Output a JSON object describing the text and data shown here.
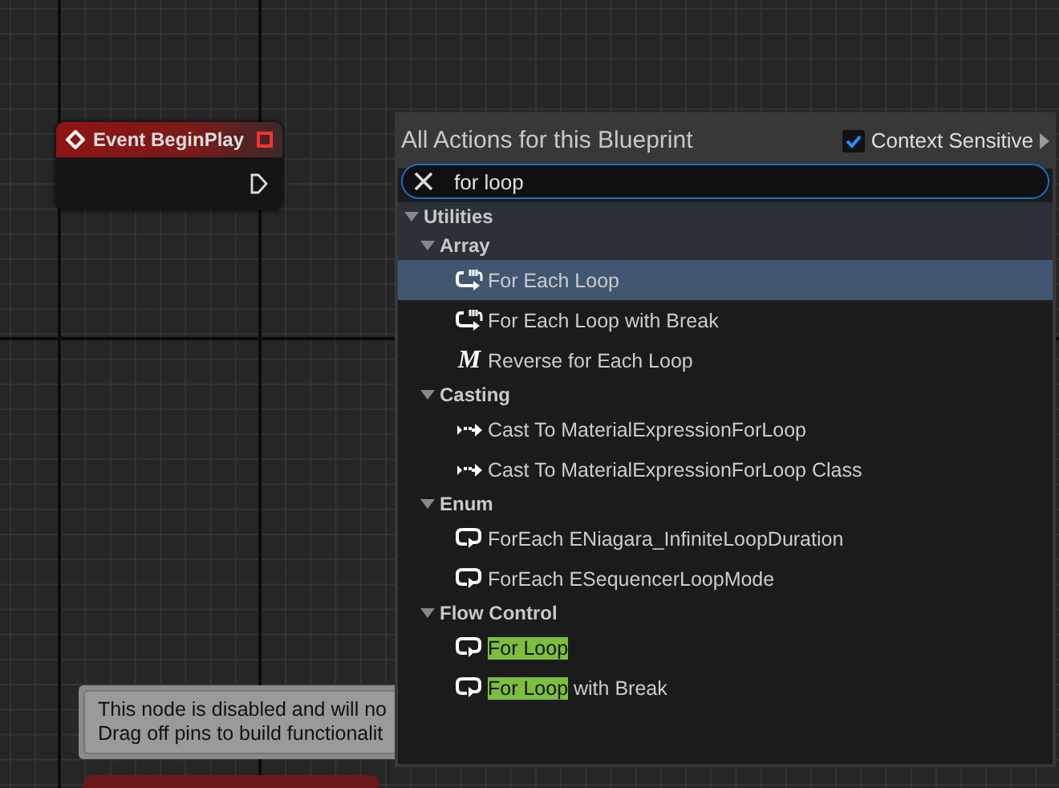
{
  "event_node": {
    "title": "Event BeginPlay"
  },
  "tooltip": {
    "lines": [
      "This node is disabled and will no",
      "Drag off pins to build functionalit"
    ]
  },
  "menu": {
    "title": "All Actions for this Blueprint",
    "context_sensitive": {
      "label": "Context Sensitive",
      "checked": true
    },
    "search": {
      "value": "for loop"
    },
    "tree": [
      {
        "label": "Utilities",
        "expanded": true,
        "children": [
          {
            "label": "Array",
            "expanded": true,
            "children": [
              {
                "kind": "loop",
                "selected": true,
                "parts": [
                  {
                    "text": "For Each Loop",
                    "highlighted": false
                  }
                ]
              },
              {
                "kind": "loop",
                "selected": false,
                "parts": [
                  {
                    "text": "For Each Loop with Break",
                    "highlighted": false
                  }
                ]
              },
              {
                "kind": "macro",
                "icon_text": "M",
                "selected": false,
                "parts": [
                  {
                    "text": "Reverse for Each Loop",
                    "highlighted": false
                  }
                ]
              }
            ]
          },
          {
            "label": "Casting",
            "expanded": true,
            "children": [
              {
                "kind": "cast",
                "selected": false,
                "parts": [
                  {
                    "text": "Cast To MaterialExpressionForLoop",
                    "highlighted": false
                  }
                ]
              },
              {
                "kind": "cast",
                "selected": false,
                "parts": [
                  {
                    "text": "Cast To MaterialExpressionForLoop Class",
                    "highlighted": false
                  }
                ]
              }
            ]
          },
          {
            "label": "Enum",
            "expanded": true,
            "children": [
              {
                "kind": "enum",
                "selected": false,
                "parts": [
                  {
                    "text": "ForEach ENiagara_InfiniteLoopDuration",
                    "highlighted": false
                  }
                ]
              },
              {
                "kind": "enum",
                "selected": false,
                "parts": [
                  {
                    "text": "ForEach ESequencerLoopMode",
                    "highlighted": false
                  }
                ]
              }
            ]
          },
          {
            "label": "Flow Control",
            "expanded": true,
            "children": [
              {
                "kind": "enum",
                "selected": false,
                "parts": [
                  {
                    "text": "For Loop",
                    "highlighted": true
                  }
                ]
              },
              {
                "kind": "enum",
                "selected": false,
                "parts": [
                  {
                    "text": "For Loop",
                    "highlighted": true
                  },
                  {
                    "text": " with Break",
                    "highlighted": false
                  }
                ]
              }
            ]
          }
        ]
      }
    ]
  }
}
